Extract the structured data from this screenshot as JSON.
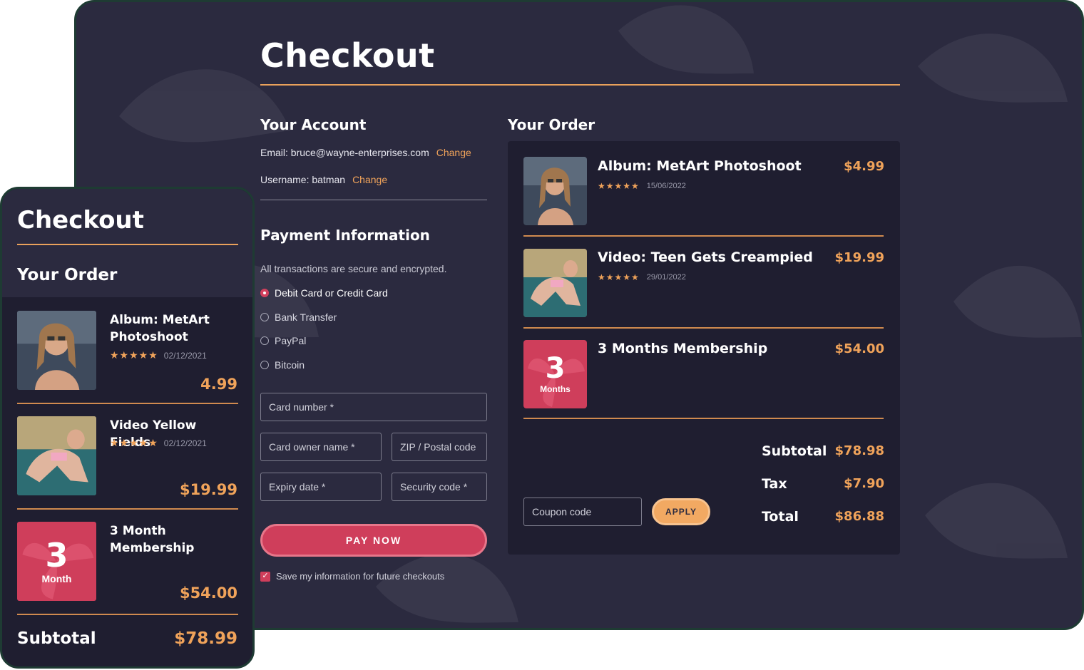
{
  "desktop": {
    "title": "Checkout",
    "account": {
      "heading": "Your Account",
      "email_label": "Email: bruce@wayne-enterprises.com",
      "username_label": "Username: batman",
      "change_label": "Change"
    },
    "payment": {
      "heading": "Payment Information",
      "secure_note": "All transactions are secure and encrypted.",
      "methods": [
        "Debit Card or Credit Card",
        "Bank Transfer",
        "PayPal",
        "Bitcoin"
      ],
      "selected_method": "Debit Card or Credit Card",
      "fields": {
        "card_number": "Card number *",
        "owner_name": "Card owner name *",
        "zip": "ZIP / Postal code *",
        "expiry": "Expiry date *",
        "security": "Security code *"
      },
      "pay_button": "PAY NOW",
      "save_info": "Save my information for future checkouts",
      "save_checked": true
    },
    "order": {
      "heading": "Your Order",
      "items": [
        {
          "name": "Album: MetArt Photoshoot",
          "stars": "★★★★★",
          "date": "15/06/2022",
          "price": "$4.99"
        },
        {
          "name": "Video: Teen Gets Creampied",
          "stars": "★★★★★",
          "date": "29/01/2022",
          "price": "$19.99"
        },
        {
          "name": "3 Months Membership",
          "price": "$54.00",
          "tile_number": "3",
          "tile_unit": "Months"
        }
      ],
      "coupon_placeholder": "Coupon code",
      "apply_button": "APPLY",
      "subtotal_label": "Subtotal",
      "subtotal_value": "$78.98",
      "tax_label": "Tax",
      "tax_value": "$7.90",
      "total_label": "Total",
      "total_value": "$86.88"
    }
  },
  "mobile": {
    "title": "Checkout",
    "order_heading": "Your Order",
    "items": [
      {
        "name": "Album: MetArt Photoshoot",
        "stars": "★★★★★",
        "date": "02/12/2021",
        "price": "4.99"
      },
      {
        "name": "Video Yellow Fields",
        "stars": "★★★★★",
        "date": "02/12/2021",
        "price": "$19.99"
      },
      {
        "name": "3 Month Membership",
        "price": "$54.00",
        "tile_number": "3",
        "tile_unit": "Month"
      }
    ],
    "subtotal_label": "Subtotal",
    "subtotal_value": "$78.99"
  },
  "colors": {
    "background": "#2b2a3f",
    "panel": "#1f1e30",
    "accent_orange": "#f0a35a",
    "accent_red": "#cf3e5b",
    "frame_border": "#1e3b33"
  }
}
